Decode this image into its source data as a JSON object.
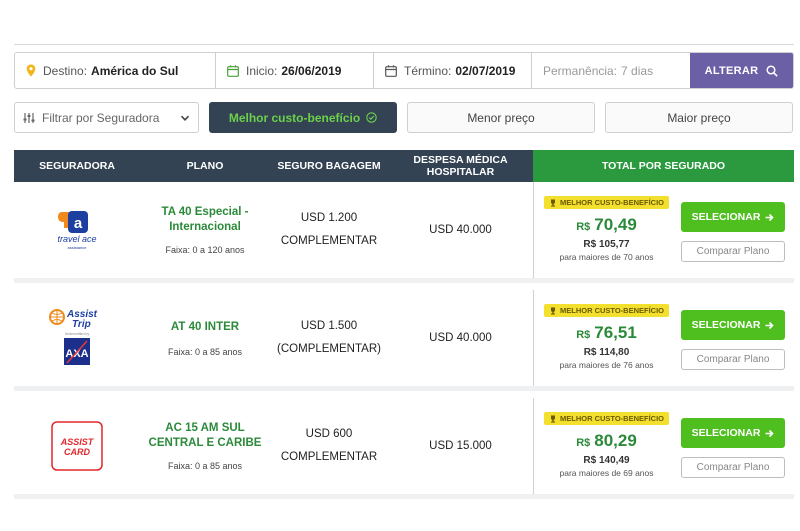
{
  "search": {
    "destino_label": "Destino:",
    "destino_value": "América do Sul",
    "inicio_label": "Inicio:",
    "inicio_value": "26/06/2019",
    "termino_label": "Término:",
    "termino_value": "02/07/2019",
    "permanencia_label": "Permanência:",
    "permanencia_value": "7 dias",
    "alterar_label": "ALTERAR"
  },
  "filters": {
    "seguradora_placeholder": "Filtrar por Seguradora",
    "best_label": "Melhor custo-benefício",
    "low_label": "Menor preço",
    "high_label": "Maior preço"
  },
  "table": {
    "headers": {
      "seguradora": "SEGURADORA",
      "plano": "PLANO",
      "bagagem": "SEGURO BAGAGEM",
      "despesa": "DESPESA MÉDICA HOSPITALAR",
      "total": "TOTAL POR SEGURADO"
    },
    "rows": [
      {
        "logo": "travel ace",
        "plan_line1": "TA 40 Especial -",
        "plan_line2": "Internacional",
        "faixa": "Faixa: 0 a 120 anos",
        "bag_line1": "USD 1.200",
        "bag_line2": "COMPLEMENTAR",
        "despesa": "USD 40.000",
        "badge": "MELHOR CUSTO-BENEFÍCIO",
        "currency": "R$",
        "price": "70,49",
        "price_old": "R$ 105,77",
        "note": "para maiores de 70 anos",
        "select_label": "SELECIONAR",
        "compare_label": "Comparar Plano"
      },
      {
        "logo": "Assist Trip",
        "plan_line1": "AT 40 INTER",
        "plan_line2": "",
        "faixa": "Faixa: 0 a 85 anos",
        "bag_line1": "USD 1.500",
        "bag_line2": "(COMPLEMENTAR)",
        "despesa": "USD 40.000",
        "badge": "MELHOR CUSTO-BENEFÍCIO",
        "currency": "R$",
        "price": "76,51",
        "price_old": "R$ 114,80",
        "note": "para maiores de 76 anos",
        "select_label": "SELECIONAR",
        "compare_label": "Comparar Plano"
      },
      {
        "logo": "ASSIST CARD",
        "plan_line1": "AC 15 AM SUL",
        "plan_line2": "CENTRAL E CARIBE",
        "faixa": "Faixa: 0 a 85 anos",
        "bag_line1": "USD 600",
        "bag_line2": "COMPLEMENTAR",
        "despesa": "USD 15.000",
        "badge": "MELHOR CUSTO-BENEFÍCIO",
        "currency": "R$",
        "price": "80,29",
        "price_old": "R$ 140,49",
        "note": "para maiores de 69 anos",
        "select_label": "SELECIONAR",
        "compare_label": "Comparar Plano"
      }
    ]
  },
  "colors": {
    "header_dark": "#334353",
    "header_green": "#2b9a3f",
    "accent_purple": "#6b5fa5",
    "button_green": "#4fbf1f",
    "badge_yellow": "#f3df2d",
    "price_green": "#2b8a3a"
  }
}
